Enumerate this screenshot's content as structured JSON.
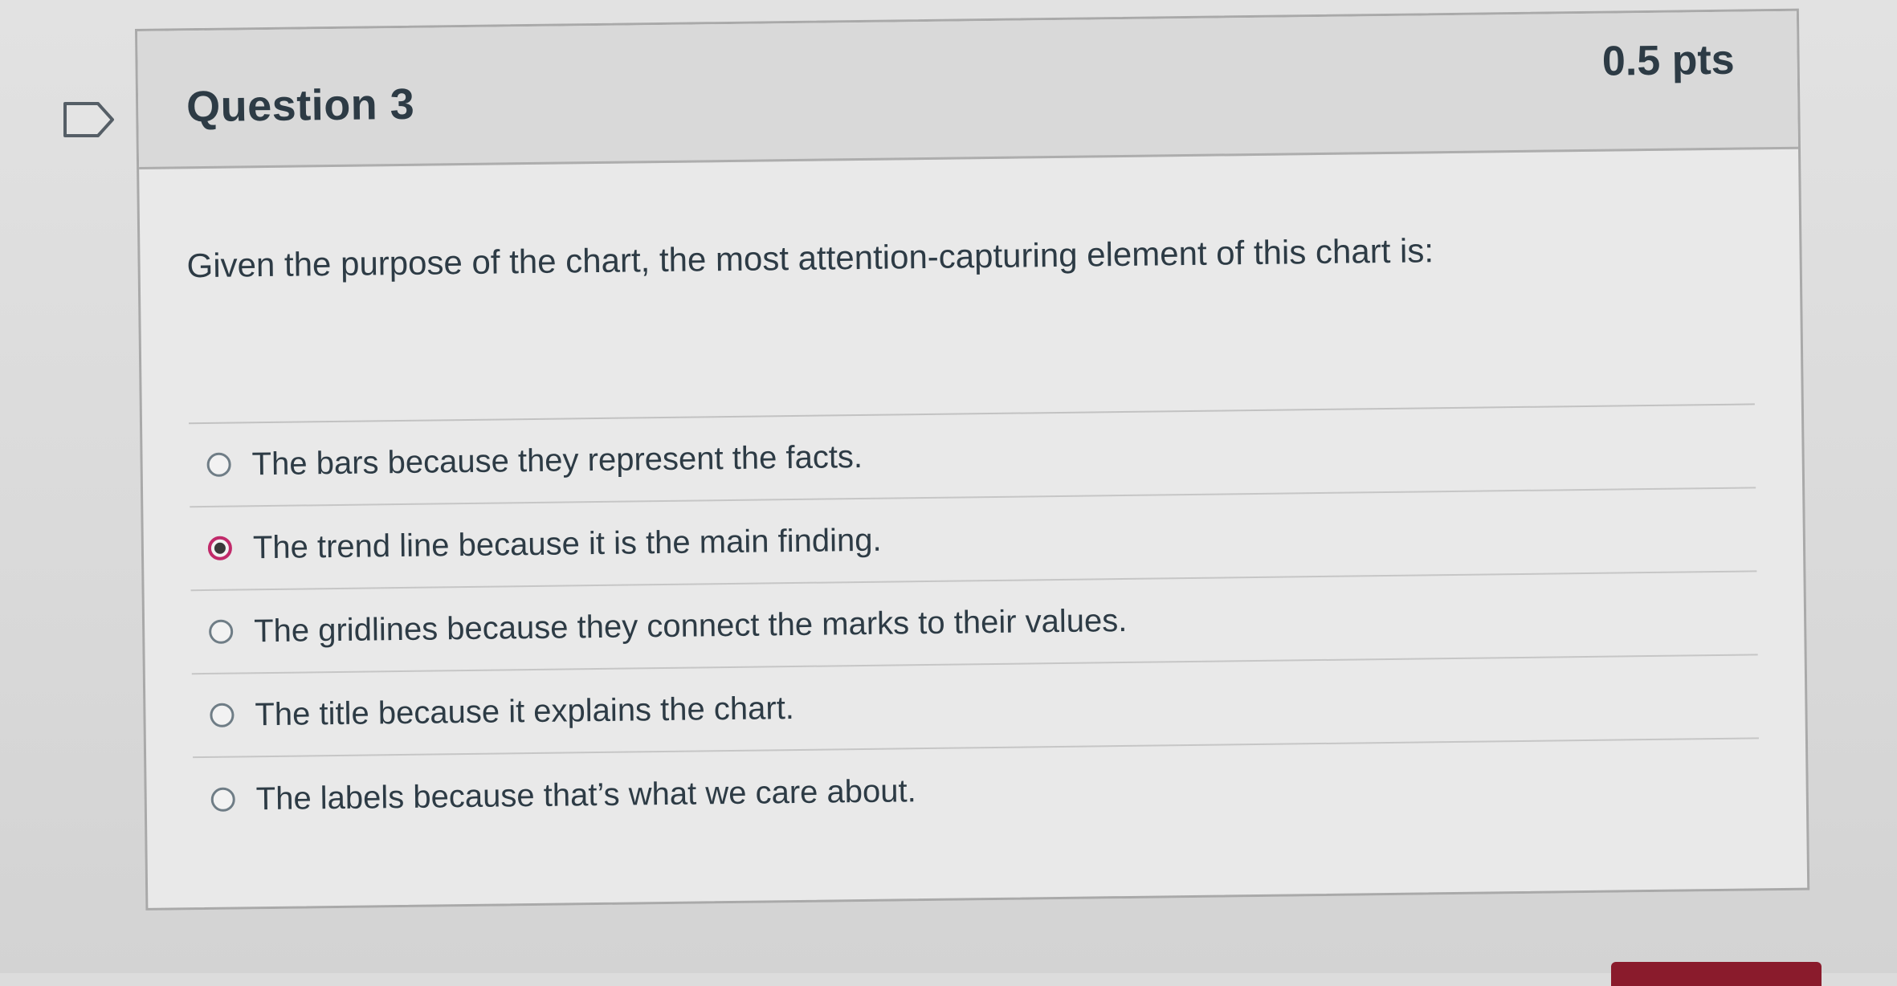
{
  "question": {
    "title": "Question 3",
    "points": "0.5 pts",
    "text": "Given the purpose of the chart, the most attention-capturing element of this chart is:"
  },
  "answers": [
    {
      "label": "The bars because they represent the facts.",
      "selected": false
    },
    {
      "label": "The trend line because it is the main finding.",
      "selected": true
    },
    {
      "label": "The gridlines because they connect the marks to their values.",
      "selected": false
    },
    {
      "label": "The title because it explains the chart.",
      "selected": false
    },
    {
      "label": "The labels because that’s what we care about.",
      "selected": false
    }
  ],
  "colors": {
    "accent": "#c12a6a",
    "text": "#2d3b45",
    "header_bg": "#d9d9d9"
  },
  "icons": {
    "flag": "flag-icon"
  }
}
